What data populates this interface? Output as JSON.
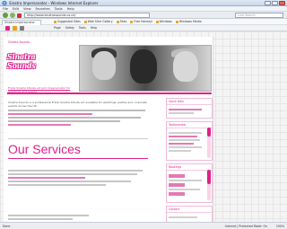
{
  "window": {
    "title": "Sinatra Impersonator - Windows Internet Explorer"
  },
  "menu": [
    "File",
    "Edit",
    "View",
    "Favorites",
    "Tools",
    "Help"
  ],
  "address": {
    "url": "http://www.sinatrasounds.co.uk/",
    "search_placeholder": "Live Search"
  },
  "tab": {
    "label": "Sinatra Impersonator"
  },
  "favorites": [
    "Suggested Sites",
    "Web Slice Gallery",
    "Sites",
    "Free Hotmail",
    "Windows",
    "Windows Media"
  ],
  "toolbar": [
    "Page",
    "Safety",
    "Tools",
    "Help"
  ],
  "page": {
    "brand_small": "Sinatra Sounds",
    "logo_text": "Sinatra Sounds",
    "tagline": "Frank Sinatra tribute act and impersonator for weddings and events",
    "intro_text": "Sinatra Sounds is a professional Frank Sinatra tribute act available for weddings, parties and corporate events across the UK.",
    "services_heading": "Our Services"
  },
  "sidebar": {
    "boxes": [
      {
        "title": "Quick links"
      },
      {
        "title": "Testimonials"
      },
      {
        "title": "Bookings"
      },
      {
        "title": "Contact"
      }
    ]
  },
  "status": {
    "text": "Done",
    "zone": "Internet | Protected Mode: On",
    "zoom": "100%"
  },
  "colors": {
    "accent": "#e0208a",
    "accent_light": "#e27bb4"
  }
}
